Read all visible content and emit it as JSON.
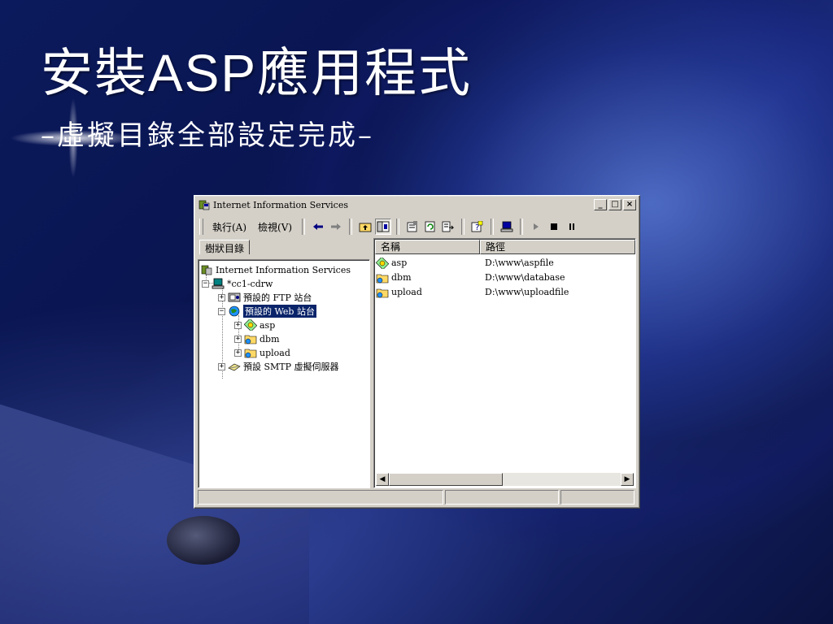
{
  "slide": {
    "title_part1": "安裝",
    "title_part2": "ASP",
    "title_part3": "應用程式",
    "subtitle": "–虛擬目錄全部設定完成–"
  },
  "window": {
    "title": "Internet Information Services",
    "minimize": "_",
    "maximize": "□",
    "close": "×"
  },
  "menu": {
    "action": "執行(A)",
    "view": "檢視(V)"
  },
  "toolbar": {
    "icons": [
      "back-arrow-icon",
      "forward-arrow-icon",
      "up-folder-icon",
      "show-tree-icon",
      "properties-icon",
      "refresh-icon",
      "export-icon",
      "help-icon",
      "computer-icon",
      "play-icon",
      "stop-icon",
      "pause-icon"
    ]
  },
  "tree_tab": "樹狀目錄",
  "tree": {
    "root": "Internet Information Services",
    "server": "*cc1-cdrw",
    "ftp": "預設的 FTP 站台",
    "web": "預設的 Web 站台",
    "asp": "asp",
    "dbm": "dbm",
    "upload": "upload",
    "smtp": "預設 SMTP 虛擬伺服器"
  },
  "list": {
    "col_name": "名稱",
    "col_path": "路徑",
    "rows": [
      {
        "name": "asp",
        "path": "D:\\www\\aspfile"
      },
      {
        "name": "dbm",
        "path": "D:\\www\\database"
      },
      {
        "name": "upload",
        "path": "D:\\www\\uploadfile"
      }
    ]
  },
  "colors": {
    "selection": "#0a246a",
    "window_face": "#d4d0c8"
  }
}
